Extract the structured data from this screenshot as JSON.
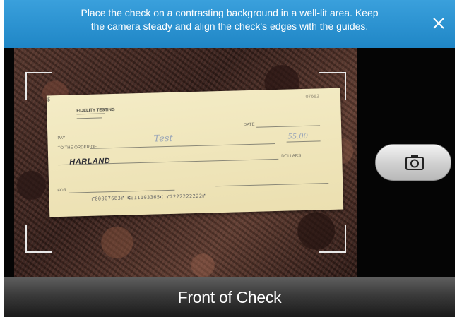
{
  "banner": {
    "line1": "Place the check on a contrasting background in a well-lit area.  Keep",
    "line2": "the camera steady and align the check's edges with the guides.",
    "close_icon": "close-icon"
  },
  "check": {
    "bank_name": "FIDELITY TESTING",
    "check_number": "07682",
    "pay_label": "PAY",
    "order_label": "TO THE ORDER OF",
    "date_label": "DATE",
    "dollars_label": "DOLLARS",
    "dollar_sign": "$",
    "payee_handwritten": "Test",
    "amount_handwritten": "55.00",
    "brand": "HARLAND",
    "memo_label": "FOR",
    "micr_line": "⑈00007683⑈  ⑆011103365⑆     ⑈2222222222⑈"
  },
  "shutter": {
    "icon": "camera-icon"
  },
  "bottom_bar": {
    "label": "Front of Check"
  },
  "colors": {
    "banner": "#2a93d2",
    "bottom_bar": "#2b2b2b",
    "shutter": "#d8d8d8"
  }
}
